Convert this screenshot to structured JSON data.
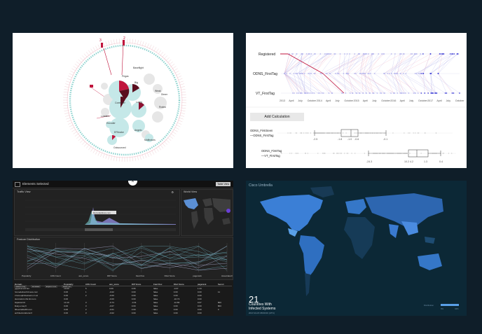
{
  "bubble": {
    "ring_top_labels": [
      "3",
      "2"
    ],
    "labels": [
      "Baseflight",
      "Pegas",
      "Big",
      "Controller",
      "Loaders",
      "Lobby",
      "Encoder",
      "EFIbrake",
      "Weak",
      "Rodeo",
      "Angelo",
      "Outsourced",
      "Multirotors",
      "Dimer"
    ]
  },
  "timeline": {
    "rows": [
      "Registered",
      "ODNS_FirstTag",
      "VT_FirstTag"
    ],
    "axis_ticks": [
      "2013",
      "April",
      "July",
      "October",
      "2014",
      "April",
      "July",
      "October",
      "2015",
      "April",
      "July",
      "October",
      "2016",
      "April",
      "July",
      "October",
      "2017",
      "April",
      "July",
      "October"
    ],
    "add_calc_label": "Add Calculation",
    "calc1": {
      "label_line1": "ODNS_FirstSeen",
      "label_line2": "—ODNS_FirstTag",
      "ticks": [
        "-2.5",
        "-1.8",
        "-1.0",
        "-0.6",
        "-0.1"
      ]
    },
    "calc2": {
      "label_line1": "ODNS_FirstTag",
      "label_line2": "—VT_FirstTag",
      "ticks": [
        "-24.3",
        "10.2 4.2",
        "1.3",
        "0.4"
      ]
    }
  },
  "dashboard": {
    "header": "Elements Selected",
    "header_button": "Table View",
    "traffic_title": "Traffic View",
    "world_title": "World View",
    "feature_title": "Feature Distribution",
    "tooltip": "blurredaddress.com",
    "axis_labels": [
      "Popularity",
      "ASN Count",
      "asn_score",
      "RIP Score",
      "Fast Flux",
      "DGA Score",
      "pagerank",
      "Associated Domain"
    ],
    "table_tabs": [
      "Select Only",
      "Whitelist",
      "Export CSV",
      "Mark Tie"
    ],
    "table_headers": [
      "Domain",
      "Popularity",
      "ASN Count",
      "asn_score",
      "RIP Score",
      "Fast Flux",
      "DGA Score",
      "pagerank",
      "Securi"
    ],
    "rows": [
      [
        "yglydmmonf.biz",
        "10.00",
        "5",
        "0.06",
        "0.06",
        "false",
        "-0.07",
        "1.44",
        ""
      ],
      [
        "homedeliverbizness.com",
        "0.00",
        "1",
        "-0.02",
        "0.00",
        "false",
        "0.00",
        "0.00",
        "11"
      ],
      [
        "zzomeqdinfeelsens.cn.at",
        "0.00",
        "2",
        "-0.00",
        "0.00",
        "false",
        "0.00",
        "0.00",
        ""
      ],
      [
        "slamzefol.mhk.biz.com",
        "0.00",
        "",
        "-0.00",
        "0.00",
        "false",
        "-10.73",
        "0.00",
        ""
      ],
      [
        "biqatcat.biz",
        "14.10",
        "3",
        "-0.74",
        "-0.31",
        "false",
        "-12.80",
        "0.07",
        "800"
      ],
      [
        "likely+maq.fr",
        "0.00",
        "3",
        "-0.07",
        "0.00",
        "false",
        "0.00",
        "0.00",
        "800"
      ],
      [
        "fifteentablefiifi.com",
        "0.00",
        "2",
        "-0.01",
        "0.00",
        "false",
        "0.00",
        "0.00",
        "0"
      ],
      [
        "architectoraborat.fr",
        "0.00",
        "3",
        "-0.02",
        "0.00",
        "false",
        "0.00",
        "0.00",
        ""
      ]
    ]
  },
  "map": {
    "brand": "Cisco Umbrella",
    "count": "21",
    "caption_line1": "Countries With",
    "caption_line2": "Infected Systems",
    "date": "2017-04-15 08:00:00 (UTC)",
    "legend_label": "Distribution",
    "legend_min": "0%",
    "legend_max": "34%"
  },
  "colors": {
    "background": "#0f1e29",
    "bubble_fill": "#c5e8e8",
    "accent_red": "#c0143c",
    "map_bg": "#0c2836"
  }
}
